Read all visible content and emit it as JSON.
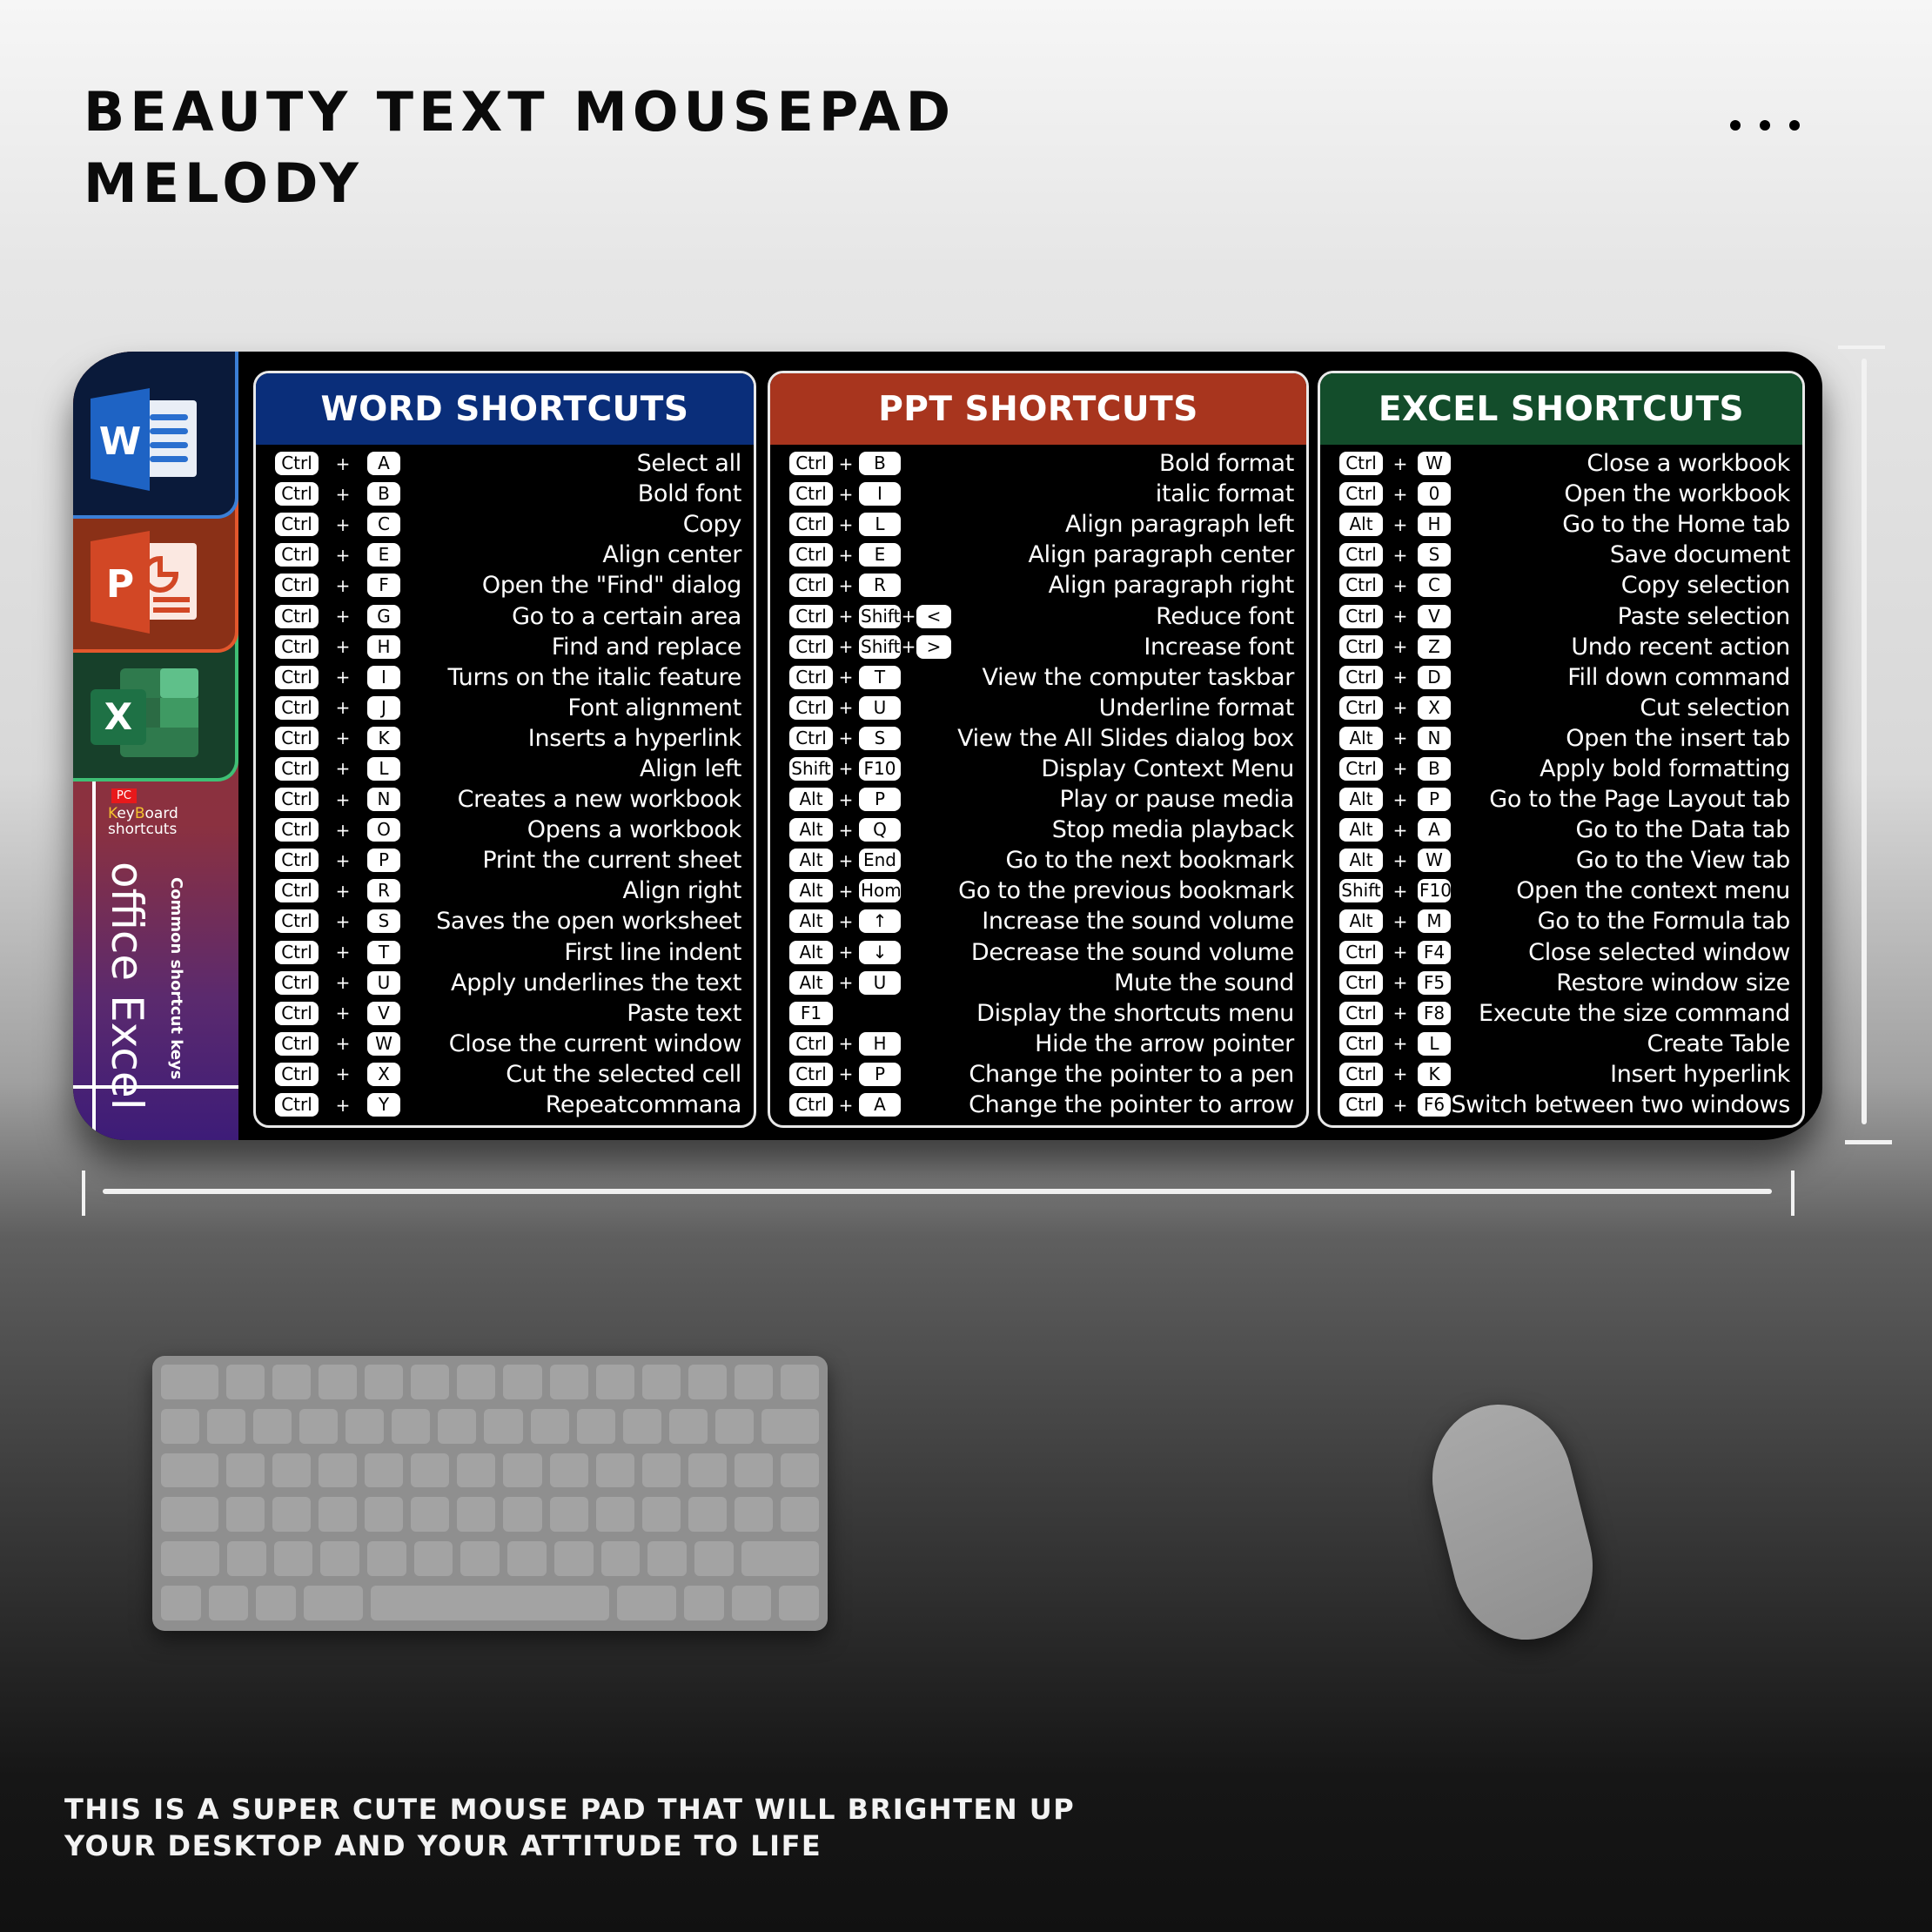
{
  "header": {
    "title_line1": "BEAUTY TEXT MOUSEPAD",
    "title_line2": "MELODY",
    "more_icon": "more-horizontal-icon"
  },
  "sidebar": {
    "apps": [
      {
        "name": "Word",
        "letter": "W",
        "color": "#1e63c4",
        "icon": "word-icon"
      },
      {
        "name": "PowerPoint",
        "letter": "P",
        "color": "#d24725",
        "icon": "powerpoint-icon"
      },
      {
        "name": "Excel",
        "letter": "X",
        "color": "#1e7145",
        "icon": "excel-icon"
      }
    ],
    "badge": "PC",
    "keyboard_label_k": "K",
    "keyboard_label_ey": "ey",
    "keyboard_label_b": "B",
    "keyboard_label_oard": "oard",
    "keyboard_label_line2": "shortcuts",
    "vertical_title": "office Excel",
    "vertical_subtitle": "Common shortcut keys"
  },
  "panels": [
    {
      "title": "WORD SHORTCUTS",
      "color": "#0a2e7a",
      "rows": [
        {
          "keys": [
            "Ctrl",
            "A"
          ],
          "desc": "Select all"
        },
        {
          "keys": [
            "Ctrl",
            "B"
          ],
          "desc": "Bold font"
        },
        {
          "keys": [
            "Ctrl",
            "C"
          ],
          "desc": "Copy"
        },
        {
          "keys": [
            "Ctrl",
            "E"
          ],
          "desc": "Align center"
        },
        {
          "keys": [
            "Ctrl",
            "F"
          ],
          "desc": "Open the \"Find\" dialog"
        },
        {
          "keys": [
            "Ctrl",
            "G"
          ],
          "desc": "Go to a certain area"
        },
        {
          "keys": [
            "Ctrl",
            "H"
          ],
          "desc": "Find and replace"
        },
        {
          "keys": [
            "Ctrl",
            "I"
          ],
          "desc": "Turns on the italic feature"
        },
        {
          "keys": [
            "Ctrl",
            "J"
          ],
          "desc": "Font alignment"
        },
        {
          "keys": [
            "Ctrl",
            "K"
          ],
          "desc": "Inserts a hyperlink"
        },
        {
          "keys": [
            "Ctrl",
            "L"
          ],
          "desc": "Align left"
        },
        {
          "keys": [
            "Ctrl",
            "N"
          ],
          "desc": "Creates a new workbook"
        },
        {
          "keys": [
            "Ctrl",
            "O"
          ],
          "desc": "Opens a workbook"
        },
        {
          "keys": [
            "Ctrl",
            "P"
          ],
          "desc": "Print the current sheet"
        },
        {
          "keys": [
            "Ctrl",
            "R"
          ],
          "desc": "Align right"
        },
        {
          "keys": [
            "Ctrl",
            "S"
          ],
          "desc": "Saves the open worksheet"
        },
        {
          "keys": [
            "Ctrl",
            "T"
          ],
          "desc": "First line indent"
        },
        {
          "keys": [
            "Ctrl",
            "U"
          ],
          "desc": "Apply underlines the text"
        },
        {
          "keys": [
            "Ctrl",
            "V"
          ],
          "desc": "Paste text"
        },
        {
          "keys": [
            "Ctrl",
            "W"
          ],
          "desc": "Close the current window"
        },
        {
          "keys": [
            "Ctrl",
            "X"
          ],
          "desc": "Cut the selected cell"
        },
        {
          "keys": [
            "Ctrl",
            "Y"
          ],
          "desc": "Repeatcommana"
        }
      ]
    },
    {
      "title": "PPT SHORTCUTS",
      "color": "#a8351e",
      "rows": [
        {
          "keys": [
            "Ctrl",
            "B"
          ],
          "desc": "Bold format"
        },
        {
          "keys": [
            "Ctrl",
            "I"
          ],
          "desc": "italic format"
        },
        {
          "keys": [
            "Ctrl",
            "L"
          ],
          "desc": "Align paragraph left"
        },
        {
          "keys": [
            "Ctrl",
            "E"
          ],
          "desc": "Align paragraph center"
        },
        {
          "keys": [
            "Ctrl",
            "R"
          ],
          "desc": "Align paragraph right"
        },
        {
          "keys": [
            "Ctrl",
            "Shift",
            "<"
          ],
          "desc": "Reduce font"
        },
        {
          "keys": [
            "Ctrl",
            "Shift",
            ">"
          ],
          "desc": "Increase font"
        },
        {
          "keys": [
            "Ctrl",
            "T"
          ],
          "desc": "View the computer taskbar"
        },
        {
          "keys": [
            "Ctrl",
            "U"
          ],
          "desc": "Underline format"
        },
        {
          "keys": [
            "Ctrl",
            "S"
          ],
          "desc": "View the All Slides dialog box"
        },
        {
          "keys": [
            "Shift",
            "F10"
          ],
          "desc": "Display Context Menu"
        },
        {
          "keys": [
            "Alt",
            "P"
          ],
          "desc": "Play or pause media"
        },
        {
          "keys": [
            "Alt",
            "Q"
          ],
          "desc": "Stop media playback"
        },
        {
          "keys": [
            "Alt",
            "End"
          ],
          "desc": "Go to the next bookmark"
        },
        {
          "keys": [
            "Alt",
            "Home"
          ],
          "desc": "Go to the previous bookmark"
        },
        {
          "keys": [
            "Alt",
            "↑"
          ],
          "desc": "Increase the sound volume"
        },
        {
          "keys": [
            "Alt",
            "↓"
          ],
          "desc": "Decrease the sound volume"
        },
        {
          "keys": [
            "Alt",
            "U"
          ],
          "desc": "Mute the sound"
        },
        {
          "keys": [
            "F1"
          ],
          "desc": "Display the shortcuts menu"
        },
        {
          "keys": [
            "Ctrl",
            "H"
          ],
          "desc": "Hide the arrow pointer"
        },
        {
          "keys": [
            "Ctrl",
            "P"
          ],
          "desc": "Change the pointer to a pen"
        },
        {
          "keys": [
            "Ctrl",
            "A"
          ],
          "desc": "Change the pointer to arrow"
        }
      ]
    },
    {
      "title": "EXCEL SHORTCUTS",
      "color": "#134d2b",
      "rows": [
        {
          "keys": [
            "Ctrl",
            "W"
          ],
          "desc": "Close a workbook"
        },
        {
          "keys": [
            "Ctrl",
            "0"
          ],
          "desc": "Open the workbook"
        },
        {
          "keys": [
            "Alt",
            "H"
          ],
          "desc": "Go to the Home tab"
        },
        {
          "keys": [
            "Ctrl",
            "S"
          ],
          "desc": "Save document"
        },
        {
          "keys": [
            "Ctrl",
            "C"
          ],
          "desc": "Copy selection"
        },
        {
          "keys": [
            "Ctrl",
            "V"
          ],
          "desc": "Paste selection"
        },
        {
          "keys": [
            "Ctrl",
            "Z"
          ],
          "desc": "Undo recent action"
        },
        {
          "keys": [
            "Ctrl",
            "D"
          ],
          "desc": "Fill down command"
        },
        {
          "keys": [
            "Ctrl",
            "X"
          ],
          "desc": "Cut selection"
        },
        {
          "keys": [
            "Alt",
            "N"
          ],
          "desc": "Open the insert tab"
        },
        {
          "keys": [
            "Ctrl",
            "B"
          ],
          "desc": "Apply bold formatting"
        },
        {
          "keys": [
            "Alt",
            "P"
          ],
          "desc": "Go to the Page Layout tab"
        },
        {
          "keys": [
            "Alt",
            "A"
          ],
          "desc": "Go to the Data tab"
        },
        {
          "keys": [
            "Alt",
            "W"
          ],
          "desc": "Go to the View tab"
        },
        {
          "keys": [
            "Shift",
            "F10"
          ],
          "desc": "Open the context menu"
        },
        {
          "keys": [
            "Alt",
            "M"
          ],
          "desc": "Go to the Formula tab"
        },
        {
          "keys": [
            "Ctrl",
            "F4"
          ],
          "desc": "Close selected window"
        },
        {
          "keys": [
            "Ctrl",
            "F5"
          ],
          "desc": "Restore window size"
        },
        {
          "keys": [
            "Ctrl",
            "F8"
          ],
          "desc": "Execute the size command"
        },
        {
          "keys": [
            "Ctrl",
            "L"
          ],
          "desc": "Create Table"
        },
        {
          "keys": [
            "Ctrl",
            "K"
          ],
          "desc": "Insert hyperlink"
        },
        {
          "keys": [
            "Ctrl",
            "F6"
          ],
          "desc": "Switch between two windows"
        }
      ]
    }
  ],
  "plus_sign": "+",
  "scene": {
    "keyboard": "keyboard-image",
    "mouse": "mouse-image"
  },
  "footer": {
    "line1": "THIS IS A SUPER CUTE MOUSE PAD THAT WILL BRIGHTEN UP",
    "line2": "YOUR DESKTOP AND YOUR ATTITUDE TO LIFE"
  }
}
